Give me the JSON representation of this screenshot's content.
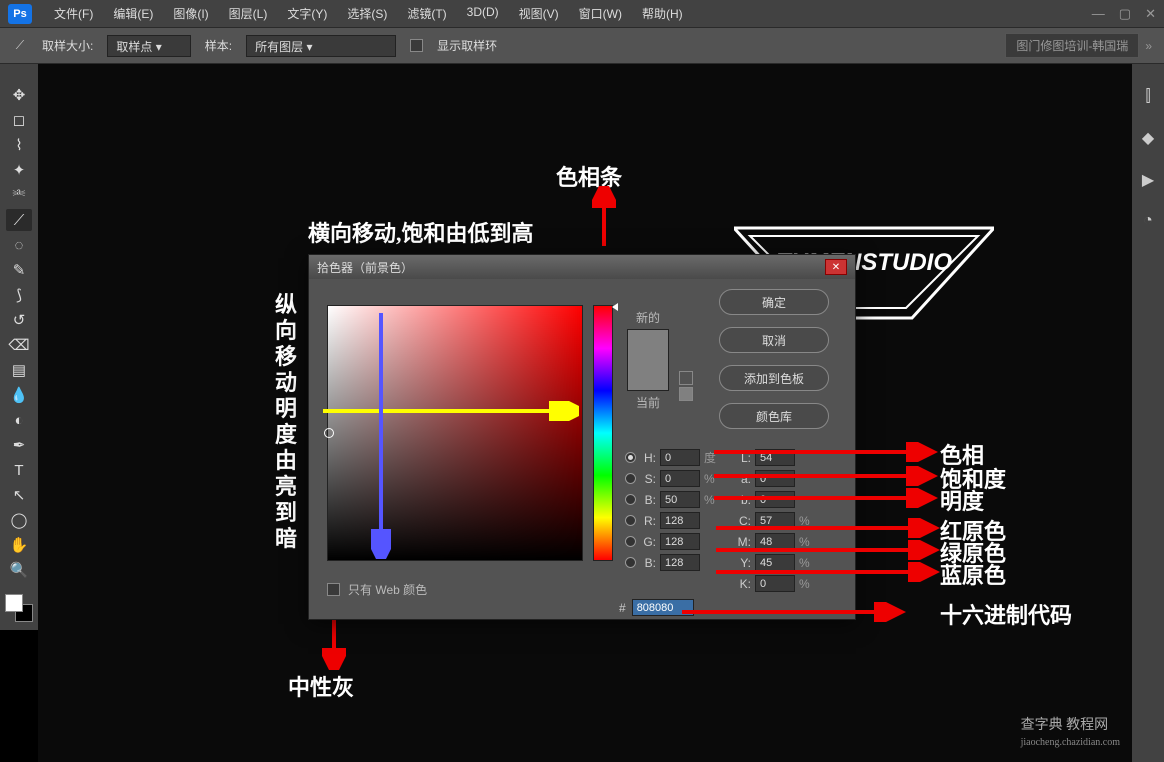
{
  "app": {
    "logo": "Ps"
  },
  "menu": {
    "items": [
      "文件(F)",
      "编辑(E)",
      "图像(I)",
      "图层(L)",
      "文字(Y)",
      "选择(S)",
      "滤镜(T)",
      "3D(D)",
      "视图(V)",
      "窗口(W)",
      "帮助(H)"
    ]
  },
  "options": {
    "sample_size_label": "取样大小:",
    "sample_size_value": "取样点",
    "sample_label": "样本:",
    "sample_value": "所有图层",
    "show_ring": "显示取样环",
    "right_tag": "图门修图培训-韩国瑞"
  },
  "tools": [
    {
      "name": "move-tool",
      "glyph": "✥"
    },
    {
      "name": "marquee-tool",
      "glyph": "◻"
    },
    {
      "name": "lasso-tool",
      "glyph": "⌇"
    },
    {
      "name": "wand-tool",
      "glyph": "✦"
    },
    {
      "name": "crop-tool",
      "glyph": "⎃"
    },
    {
      "name": "eyedropper-tool",
      "glyph": "⟋",
      "sel": true
    },
    {
      "name": "healing-tool",
      "glyph": "◌"
    },
    {
      "name": "brush-tool",
      "glyph": "✎"
    },
    {
      "name": "stamp-tool",
      "glyph": "⟆"
    },
    {
      "name": "history-brush",
      "glyph": "↺"
    },
    {
      "name": "eraser-tool",
      "glyph": "⌫"
    },
    {
      "name": "gradient-tool",
      "glyph": "▤"
    },
    {
      "name": "blur-tool",
      "glyph": "💧"
    },
    {
      "name": "dodge-tool",
      "glyph": "◐"
    },
    {
      "name": "pen-tool",
      "glyph": "✒"
    },
    {
      "name": "type-tool",
      "glyph": "T"
    },
    {
      "name": "path-tool",
      "glyph": "↖"
    },
    {
      "name": "shape-tool",
      "glyph": "◯"
    },
    {
      "name": "hand-tool",
      "glyph": "✋"
    },
    {
      "name": "zoom-tool",
      "glyph": "🔍"
    }
  ],
  "rightbar": [
    "⫿",
    "◆",
    "▶",
    "◔"
  ],
  "picker": {
    "title": "拾色器（前景色）",
    "new_label": "新的",
    "current_label": "当前",
    "buttons": {
      "ok": "确定",
      "cancel": "取消",
      "add": "添加到色板",
      "lib": "颜色库"
    },
    "fields": {
      "H": "0",
      "H_u": "度",
      "S": "0",
      "S_u": "%",
      "Bv": "50",
      "Bv_u": "%",
      "R": "128",
      "G": "128",
      "Bb": "128",
      "L": "54",
      "a": "0",
      "b": "0",
      "C": "57",
      "Cu": "%",
      "M": "48",
      "Mu": "%",
      "Y": "45",
      "Yu": "%",
      "K": "0",
      "Ku": "%"
    },
    "hex": "808080",
    "webonly": "只有 Web 颜色"
  },
  "annotations": {
    "top": "色相条",
    "horiz": "横向移动,饱和由低到高",
    "vert": "纵向移动明度由亮到暗",
    "bottom": "中性灰",
    "side": [
      "色相",
      "饱和度",
      "明度",
      "红原色",
      "绿原色",
      "蓝原色",
      "十六进制代码"
    ]
  },
  "watermark": {
    "main": "查字典 教程网",
    "sub": "jiaocheng.chazidian.com"
  }
}
